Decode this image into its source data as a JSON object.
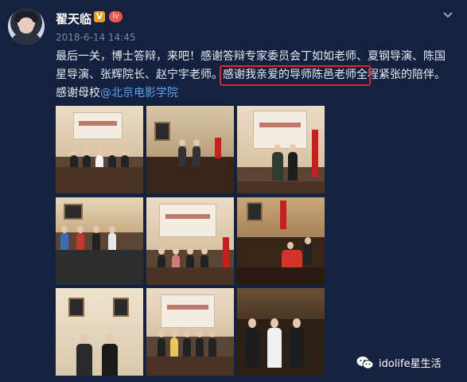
{
  "user": {
    "name": "翟天临",
    "verified_badge": "V",
    "level_badge": "lv"
  },
  "post": {
    "time": "2018-6-14 14:45",
    "lines": [
      "最后一关，博士答辩，来吧！感谢答辩专家委员会丁如如老师、夏钢导演、陈国",
      "星导演、张辉院长、赵宁宇老师。",
      "感谢我亲爱的导师陈邑老师全",
      "程紧张的陪伴。",
      "感谢母校",
      "@北京电影学院"
    ]
  },
  "photos": [
    {
      "name": "photo-1"
    },
    {
      "name": "photo-2"
    },
    {
      "name": "photo-3"
    },
    {
      "name": "photo-4"
    },
    {
      "name": "photo-5"
    },
    {
      "name": "photo-6"
    },
    {
      "name": "photo-7"
    },
    {
      "name": "photo-8"
    },
    {
      "name": "photo-9"
    }
  ],
  "watermark": {
    "text": "idolife星生活"
  },
  "colors": {
    "background": "#14213f",
    "link": "#5aa2f0",
    "highlight_box": "#e0262c",
    "time": "#7c869c"
  },
  "icons": {
    "menu": "chevron-down-icon",
    "watermark": "wechat-icon"
  }
}
